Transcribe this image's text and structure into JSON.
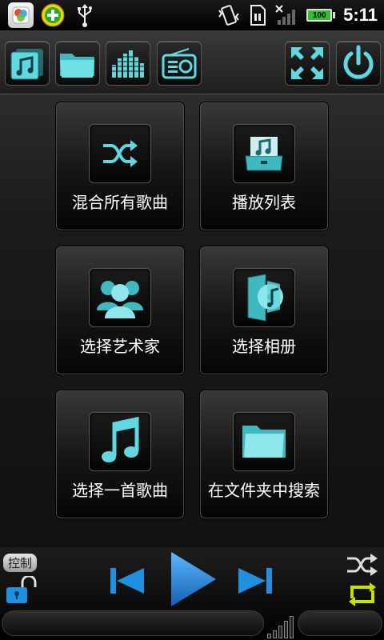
{
  "status_bar": {
    "time": "5:11",
    "battery_level": "100",
    "icons": [
      "app-store-icon",
      "add-icon",
      "usb-icon",
      "vibrate-icon",
      "sim-icon",
      "signal-icon",
      "battery-icon"
    ]
  },
  "toolbar": {
    "buttons": [
      "library-icon",
      "folder-icon",
      "equalizer-icon",
      "radio-icon",
      "fullscreen-icon",
      "power-icon"
    ]
  },
  "menu": {
    "items": [
      {
        "label": "混合所有歌曲",
        "icon": "shuffle-icon"
      },
      {
        "label": "播放列表",
        "icon": "playlist-icon"
      },
      {
        "label": "选择艺术家",
        "icon": "artists-icon"
      },
      {
        "label": "选择相册",
        "icon": "album-icon"
      },
      {
        "label": "选择一首歌曲",
        "icon": "song-icon"
      },
      {
        "label": "在文件夹中搜索",
        "icon": "folder-search-icon"
      }
    ]
  },
  "controls": {
    "control_label": "控制",
    "icons": [
      "unlock-icon",
      "previous-icon",
      "play-icon",
      "next-icon",
      "shuffle-icon",
      "repeat-icon"
    ],
    "accent_color": "#1f8fe0",
    "repeat_color": "#c8e000"
  }
}
